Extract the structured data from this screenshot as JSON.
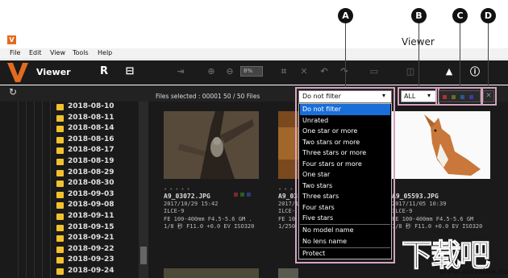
{
  "window": {
    "title": "Viewer",
    "app_badge": "V"
  },
  "menu": [
    "File",
    "Edit",
    "View",
    "Tools",
    "Help"
  ],
  "toolbar": {
    "title": "Viewer",
    "zoom": "8%"
  },
  "sidebar": {
    "refresh_icon": "refresh-icon",
    "folders": [
      "2018-08-10",
      "2018-08-11",
      "2018-08-14",
      "2018-08-16",
      "2018-08-17",
      "2018-08-19",
      "2018-08-29",
      "2018-08-30",
      "2018-09-03",
      "2018-09-08",
      "2018-09-11",
      "2018-09-15",
      "2018-09-21",
      "2018-09-22",
      "2018-09-23",
      "2018-09-24"
    ]
  },
  "status": {
    "files_selected": "Files selected : 00001   50 / 50 Files"
  },
  "thumbnails": [
    {
      "file": "A9_03072.JPG",
      "date": "2017/10/29 15:42",
      "camera": "ILCE-9",
      "lens": "FE 100-400mm F4.5-5.6 GM .",
      "exposure": "1/8 秒 F11.0 +0.0 EV ISO320"
    },
    {
      "file": "A9_03",
      "date": "2017/1",
      "camera": "ILCE-",
      "lens": "FE 10",
      "exposure": "1/250"
    },
    {
      "file": "A9_05593.JPG",
      "date": "2017/11/05 10:39",
      "camera": "ILCE-9",
      "lens": "FE 100-400mm F4.5-5.6 GM",
      "exposure": "1/8 秒 F11.0 +0.0 EV ISO320"
    }
  ],
  "filter": {
    "selected": "Do not filter",
    "options_group1": [
      "Do not filter",
      "Unrated",
      "One star or more",
      "Two stars or more",
      "Three stars or more",
      "Four stars or more",
      "One star",
      "Two stars",
      "Three stars",
      "Four stars",
      "Five stars"
    ],
    "options_group2": [
      "No model name",
      "No lens name"
    ],
    "options_group3": [
      "Protect"
    ]
  },
  "filter_all": "ALL",
  "filter_close": "✕",
  "callouts": [
    "A",
    "B",
    "C",
    "D"
  ],
  "watermark": {
    "big": "下载吧",
    "small": "www.xiazaiba.com"
  },
  "colors": {
    "accent": "#1a6ed8",
    "folder": "#f2c12e",
    "brand": "#e36b1e",
    "highlight": "#d6a3bf"
  }
}
